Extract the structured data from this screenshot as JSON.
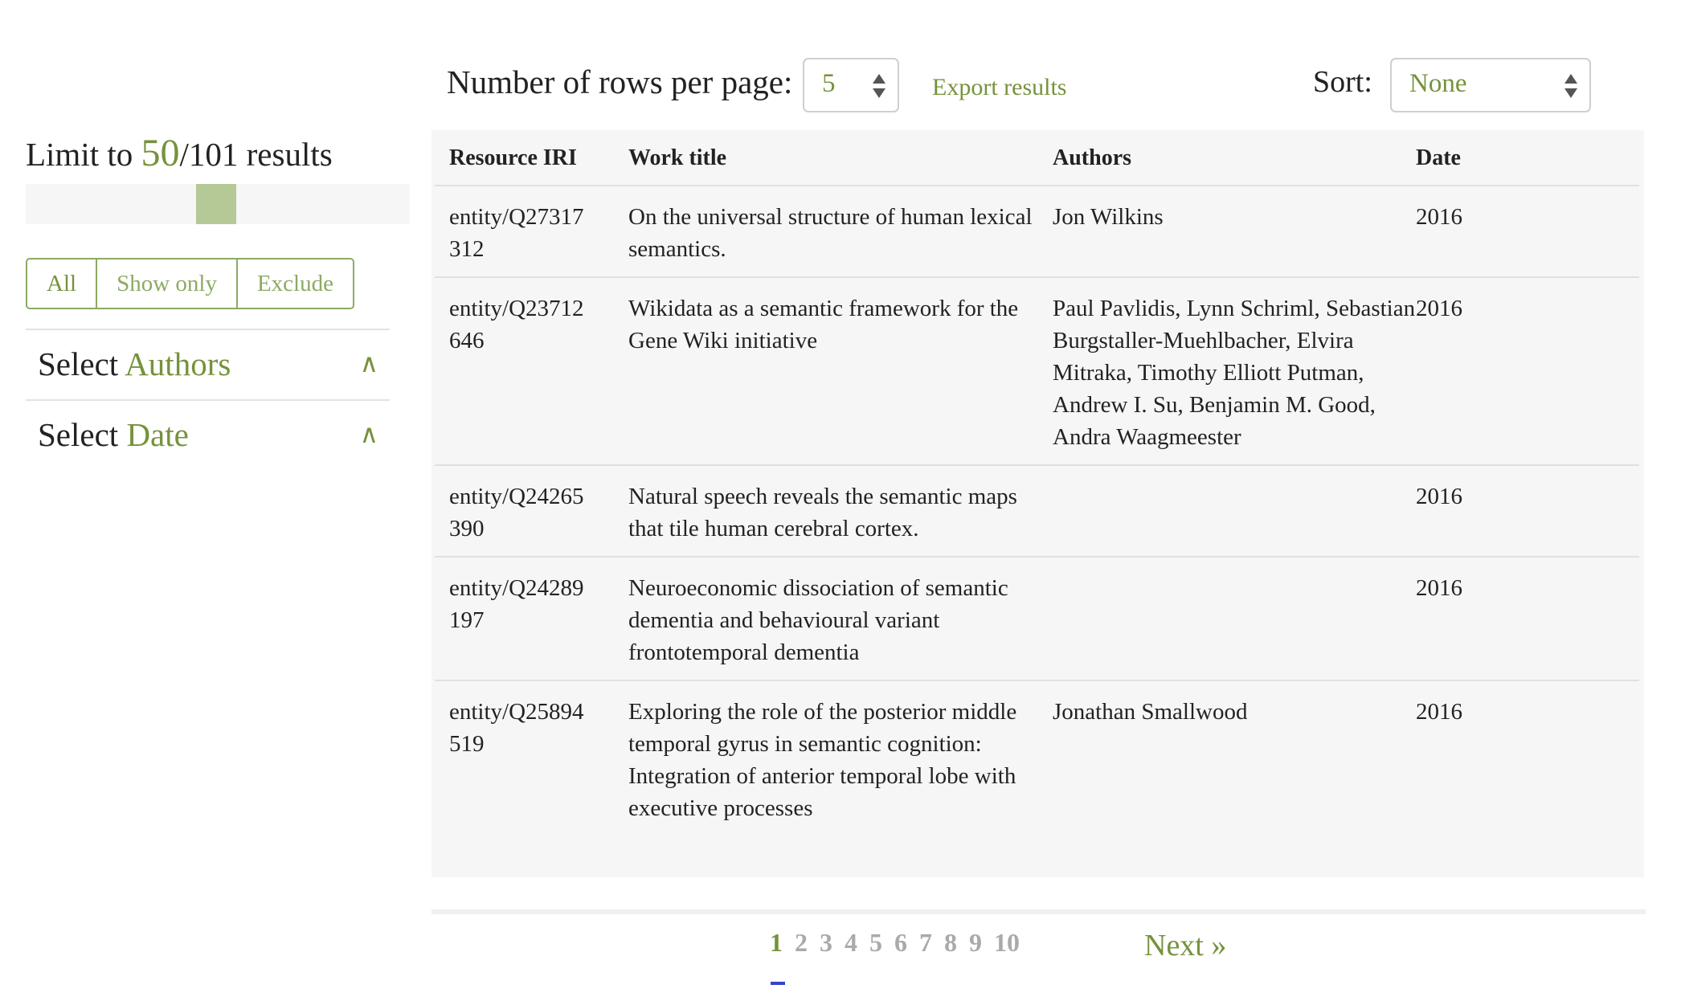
{
  "limit": {
    "prefix": "Limit to",
    "value": "50",
    "suffix": "/101 results",
    "fraction": 0.495
  },
  "filter_modes": [
    "All",
    "Show only",
    "Exclude"
  ],
  "selected_filter_mode": "All",
  "facets": [
    {
      "prefix": "Select",
      "name": "Authors",
      "caret": "∧"
    },
    {
      "prefix": "Select",
      "name": "Date",
      "caret": "∧"
    }
  ],
  "toolbar": {
    "rows_label": "Number of rows per page:",
    "rows_value": "5",
    "export_label": "Export results",
    "sort_label": "Sort:",
    "sort_value": "None"
  },
  "table": {
    "columns": [
      "Resource IRI",
      "Work title",
      "Authors",
      "Date"
    ],
    "rows": [
      {
        "iri": "entity/Q27317\n312",
        "title": "On the universal structure of human lexical semantics.",
        "authors": "Jon Wilkins",
        "date": "2016"
      },
      {
        "iri": "entity/Q23712\n646",
        "title": "Wikidata as a semantic framework for the Gene Wiki initiative",
        "authors": "Paul Pavlidis, Lynn Schriml, Sebastian Burgstaller-Muehlbacher, Elvira Mitraka, Timothy Elliott Putman, Andrew I. Su, Benjamin M. Good, Andra Waagmeester",
        "date": "2016"
      },
      {
        "iri": "entity/Q24265\n390",
        "title": "Natural speech reveals the semantic maps that tile human cerebral cortex.",
        "authors": "",
        "date": "2016"
      },
      {
        "iri": "entity/Q24289\n197",
        "title": "Neuroeconomic dissociation of semantic dementia and behavioural variant frontotemporal dementia",
        "authors": "",
        "date": "2016"
      },
      {
        "iri": "entity/Q25894\n519",
        "title": "Exploring the role of the posterior middle temporal gyrus in semantic cognition: Integration of anterior temporal lobe with executive processes",
        "authors": "Jonathan Smallwood",
        "date": "2016"
      }
    ]
  },
  "pagination": {
    "pages": [
      "1",
      "2",
      "3",
      "4",
      "5",
      "6",
      "7",
      "8",
      "9",
      "10"
    ],
    "current": "1",
    "next_label": "Next »"
  },
  "colors": {
    "accent": "#76923c",
    "slider_thumb": "#b4c996",
    "table_bg": "#f6f6f6",
    "current_underline": "#3344cc"
  }
}
